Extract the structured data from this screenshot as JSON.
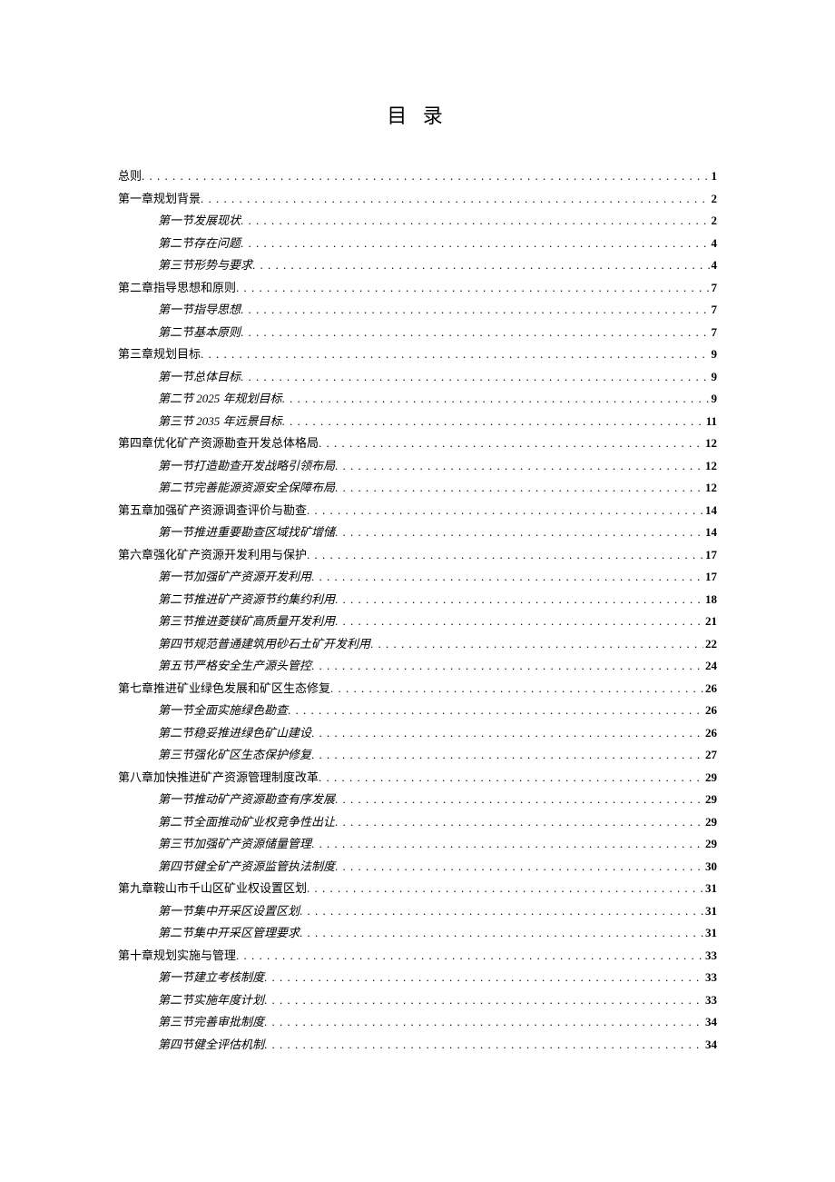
{
  "title": "目 录",
  "entries": [
    {
      "level": 1,
      "label": "总则",
      "page": "1"
    },
    {
      "level": 1,
      "label": "第一章规划背景",
      "page": "2"
    },
    {
      "level": 2,
      "label": "第一节发展现状",
      "page": "2"
    },
    {
      "level": 2,
      "label": "第二节存在问题",
      "page": "4"
    },
    {
      "level": 2,
      "label": "第三节形势与要求",
      "page": "4"
    },
    {
      "level": 1,
      "label": "第二章指导思想和原则",
      "page": "7"
    },
    {
      "level": 2,
      "label": "第一节指导思想",
      "page": "7"
    },
    {
      "level": 2,
      "label": "第二节基本原则",
      "page": "7"
    },
    {
      "level": 1,
      "label": "第三章规划目标",
      "page": "9"
    },
    {
      "level": 2,
      "label": "第一节总体目标",
      "page": "9"
    },
    {
      "level": 2,
      "label": "第二节 2025 年规划目标",
      "page": "9"
    },
    {
      "level": 2,
      "label": "第三节 2035 年远景目标",
      "page": "11"
    },
    {
      "level": 1,
      "label": "第四章优化矿产资源勘查开发总体格局",
      "page": "12"
    },
    {
      "level": 2,
      "label": "第一节打造勘查开发战略引领布局",
      "page": "12"
    },
    {
      "level": 2,
      "label": "第二节完善能源资源安全保障布局",
      "page": "12"
    },
    {
      "level": 1,
      "label": "第五章加强矿产资源调查评价与勘查",
      "page": "14"
    },
    {
      "level": 2,
      "label": "第一节推进重要勘查区域找矿增储",
      "page": "14"
    },
    {
      "level": 1,
      "label": "第六章强化矿产资源开发利用与保护",
      "page": "17"
    },
    {
      "level": 2,
      "label": "第一节加强矿产资源开发利用",
      "page": "17"
    },
    {
      "level": 2,
      "label": "第二节推进矿产资源节约集约利用",
      "page": "18"
    },
    {
      "level": 2,
      "label": "第三节推进菱镁矿高质量开发利用",
      "page": "21"
    },
    {
      "level": 2,
      "label": "第四节规范普通建筑用砂石土矿开发利用",
      "page": "22"
    },
    {
      "level": 2,
      "label": "第五节严格安全生产源头管控",
      "page": "24"
    },
    {
      "level": 1,
      "label": "第七章推进矿业绿色发展和矿区生态修复",
      "page": "26"
    },
    {
      "level": 2,
      "label": "第一节全面实施绿色勘查",
      "page": "26"
    },
    {
      "level": 2,
      "label": "第二节稳妥推进绿色矿山建设",
      "page": "26"
    },
    {
      "level": 2,
      "label": "第三节强化矿区生态保护修复",
      "page": "27"
    },
    {
      "level": 1,
      "label": "第八章加快推进矿产资源管理制度改革",
      "page": "29"
    },
    {
      "level": 2,
      "label": "第一节推动矿产资源勘查有序发展",
      "page": "29"
    },
    {
      "level": 2,
      "label": "第二节全面推动矿业权竞争性出让",
      "page": "29"
    },
    {
      "level": 2,
      "label": "第三节加强矿产资源储量管理",
      "page": "29"
    },
    {
      "level": 2,
      "label": "第四节健全矿产资源监管执法制度",
      "page": "30"
    },
    {
      "level": 1,
      "label": "第九章鞍山市千山区矿业权设置区划",
      "page": "31"
    },
    {
      "level": 2,
      "label": "第一节集中开采区设置区划",
      "page": "31"
    },
    {
      "level": 2,
      "label": "第二节集中开采区管理要求",
      "page": "31"
    },
    {
      "level": 1,
      "label": "第十章规划实施与管理",
      "page": "33"
    },
    {
      "level": 2,
      "label": "第一节建立考核制度",
      "page": "33"
    },
    {
      "level": 2,
      "label": "第二节实施年度计划",
      "page": "33"
    },
    {
      "level": 2,
      "label": "第三节完善审批制度",
      "page": "34"
    },
    {
      "level": 2,
      "label": "第四节健全评估机制",
      "page": "34"
    }
  ]
}
